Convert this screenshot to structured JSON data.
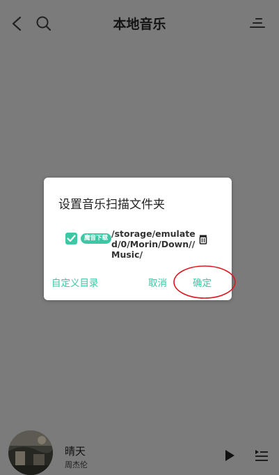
{
  "header": {
    "title": "本地音乐",
    "icons": [
      "back-arrow-icon",
      "search-icon",
      "sort-lines-icon"
    ]
  },
  "dialog": {
    "title": "设置音乐扫描文件夹",
    "folder": {
      "checked": true,
      "badge": "魔音下载",
      "path": "/storage/emulated/0/Morin/Down//Music/"
    },
    "buttons": {
      "custom": "自定义目录",
      "cancel": "取消",
      "confirm": "确定"
    }
  },
  "player": {
    "song": "晴天",
    "artist": "周杰伦"
  },
  "colors": {
    "accent": "#3cc8a5",
    "overlay": "#7b7b7b",
    "annotation": "#e0141e"
  }
}
